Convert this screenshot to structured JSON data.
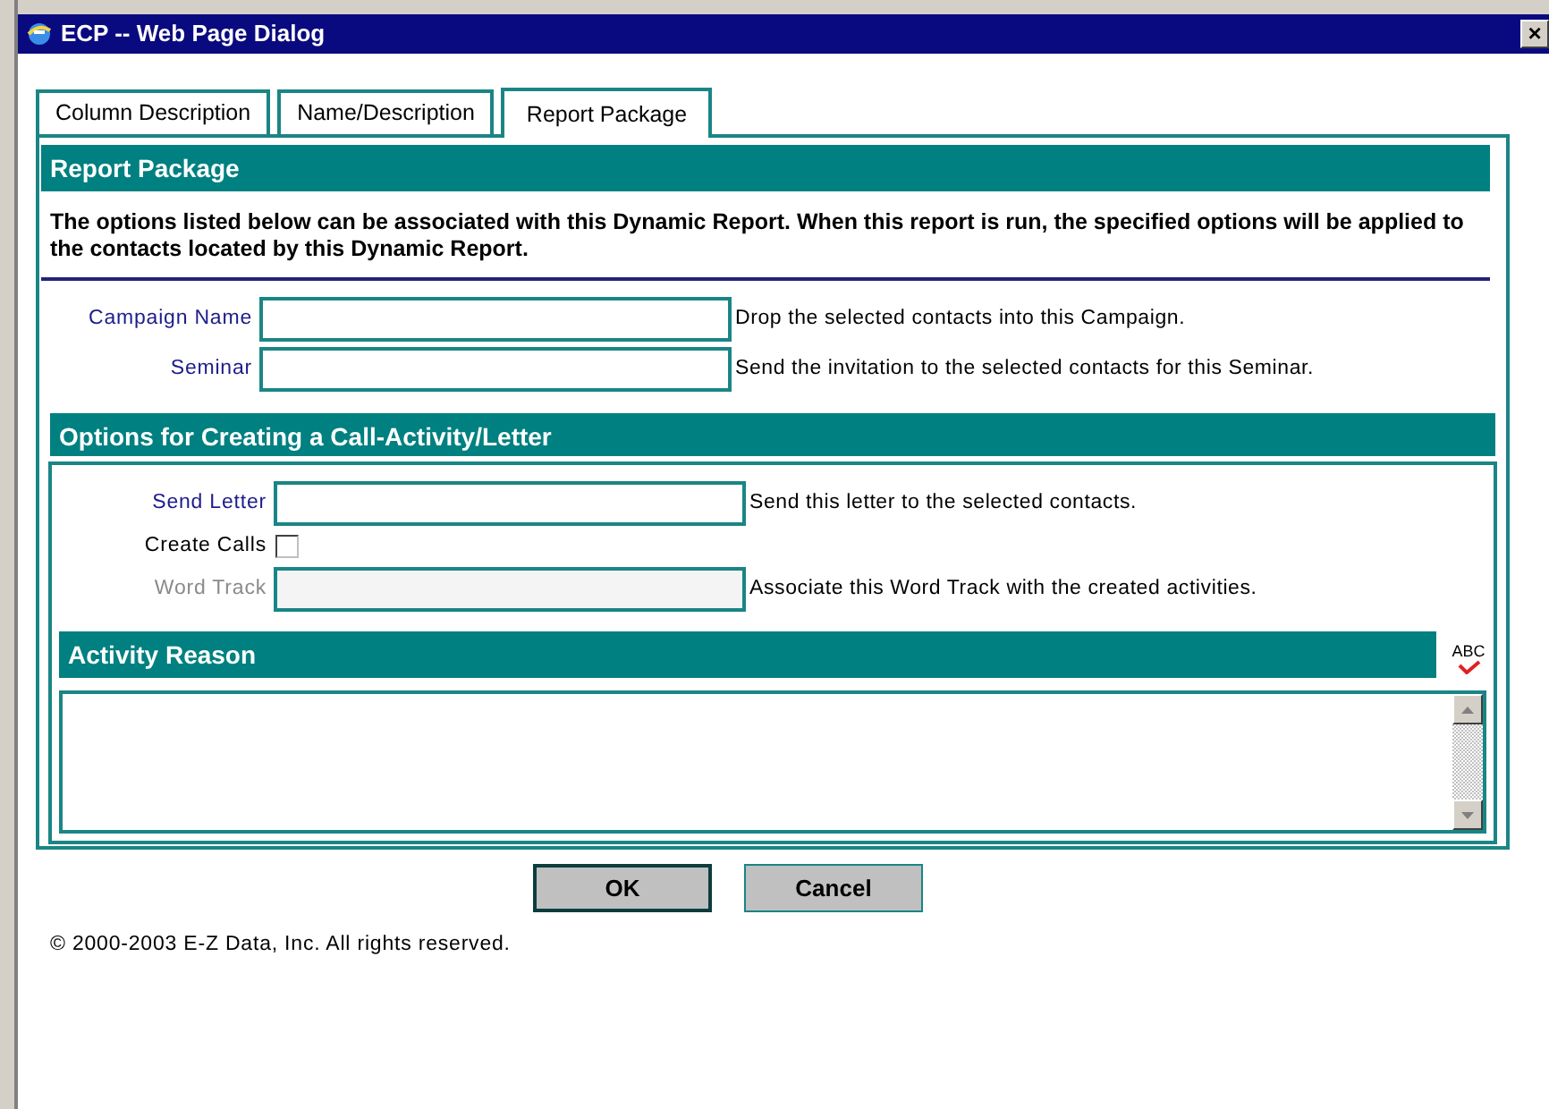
{
  "window": {
    "title": "ECP -- Web Page Dialog",
    "close": "×"
  },
  "tabs": [
    {
      "label": "Column Description",
      "selected": false
    },
    {
      "label": "Name/Description",
      "selected": false
    },
    {
      "label": "Report Package",
      "selected": true
    }
  ],
  "section": {
    "title": "Report Package",
    "description": "The options listed below can be associated with this Dynamic Report. When this report is run, the specified options will be applied to the contacts located by this Dynamic Report."
  },
  "package_fields": [
    {
      "label": "Campaign Name",
      "linked": true,
      "disabled": false,
      "hint": "Drop the selected contacts into this Campaign."
    },
    {
      "label": "Seminar",
      "linked": true,
      "disabled": false,
      "hint": "Send the invitation to the selected contacts for this Seminar."
    }
  ],
  "options": {
    "title": "Options for Creating a Call-Activity/Letter",
    "fields": [
      {
        "kind": "text",
        "label": "Send Letter",
        "linked": true,
        "disabled": false,
        "hint": "Send this letter to the selected contacts."
      },
      {
        "kind": "checkbox",
        "label": "Create Calls",
        "linked": false,
        "disabled": false,
        "checked": false
      },
      {
        "kind": "text",
        "label": "Word Track",
        "linked": false,
        "disabled": true,
        "hint": "Associate this Word Track with the created activities."
      }
    ],
    "activity_reason": {
      "title": "Activity Reason",
      "spellcheck": "ABC"
    }
  },
  "buttons": [
    {
      "label": "OK",
      "default": true
    },
    {
      "label": "Cancel",
      "default": false
    }
  ],
  "footer": "© 2000-2003 E-Z Data, Inc. All rights reserved."
}
